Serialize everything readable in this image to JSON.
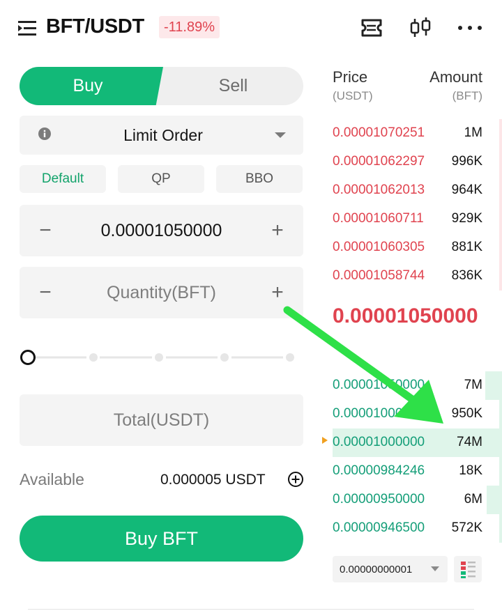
{
  "header": {
    "pair": "BFT/USDT",
    "change": "-11.89%",
    "icons": [
      "menu-icon",
      "ticket-icon",
      "candlestick-icon",
      "more-icon"
    ]
  },
  "trade": {
    "tabs": {
      "buy": "Buy",
      "sell": "Sell"
    },
    "order_type": "Limit Order",
    "modes": [
      "Default",
      "QP",
      "BBO"
    ],
    "price_value": "0.00001050000",
    "quantity_placeholder": "Quantity(BFT)",
    "total_placeholder": "Total(USDT)",
    "available_label": "Available",
    "available_value": "0.000005 USDT",
    "submit_label": "Buy BFT",
    "minus": "−",
    "plus": "+"
  },
  "orderbook": {
    "price_header": "Price",
    "price_unit": "(USDT)",
    "amount_header": "Amount",
    "amount_unit": "(BFT)",
    "asks": [
      {
        "price": "0.00001070251",
        "amount": "1M",
        "depth": 0.01
      },
      {
        "price": "0.00001062297",
        "amount": "996K",
        "depth": 0.01
      },
      {
        "price": "0.00001062013",
        "amount": "964K",
        "depth": 0.01
      },
      {
        "price": "0.00001060711",
        "amount": "929K",
        "depth": 0.01
      },
      {
        "price": "0.00001060305",
        "amount": "881K",
        "depth": 0.01
      },
      {
        "price": "0.00001058744",
        "amount": "836K",
        "depth": 0.01
      }
    ],
    "mid_price": "0.00001050000",
    "bids": [
      {
        "price": "0.00001050000",
        "amount": "7M",
        "depth": 0.1
      },
      {
        "price": "0.00001000000",
        "amount": "950K",
        "depth": 0.01
      },
      {
        "price": "0.00001000000",
        "amount": "74M",
        "depth": 1.0
      },
      {
        "price": "0.00000984246",
        "amount": "18K",
        "depth": 0.01
      },
      {
        "price": "0.00000950000",
        "amount": "6M",
        "depth": 0.09
      },
      {
        "price": "0.00000946500",
        "amount": "572K",
        "depth": 0.01
      }
    ],
    "precision": "0.00000000001"
  },
  "colors": {
    "buy": "#12b978",
    "ask": "#e0434f",
    "bid": "#149e78",
    "annotation_arrow": "#2ee048"
  }
}
